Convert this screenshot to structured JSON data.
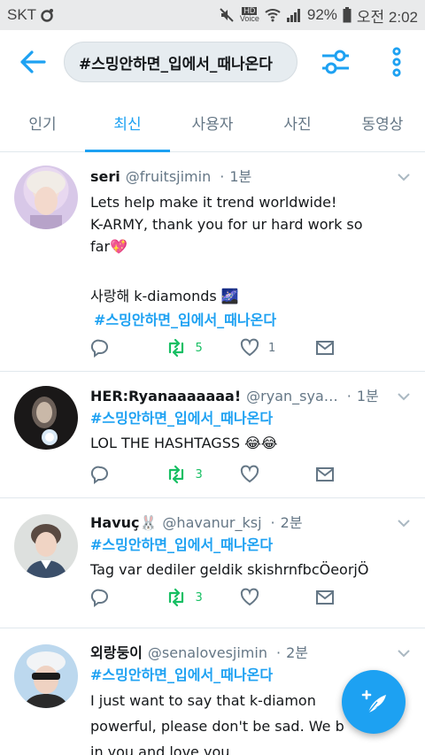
{
  "statusbar": {
    "carrier": "SKT",
    "hd_label": "HD",
    "voice_label": "Voice",
    "battery": "92%",
    "time": "오전 2:02"
  },
  "search": {
    "query": "#스밍안하면_입에서_때나온다"
  },
  "tabs": [
    {
      "label": "인기"
    },
    {
      "label": "최신",
      "active": true
    },
    {
      "label": "사용자"
    },
    {
      "label": "사진"
    },
    {
      "label": "동영상"
    }
  ],
  "tweets": [
    {
      "name": "seri",
      "handle": "@fruitsjimin",
      "time": "1분",
      "lines": [
        "Lets help make it trend worldwide!",
        "K-ARMY, thank you for ur hard work so",
        "far💖",
        "",
        "사랑해 k-diamonds 🌌"
      ],
      "hashtag": "#스밍안하면_입에서_때나온다",
      "retweets": "5",
      "likes": "1"
    },
    {
      "name": "HER:Ryanaaaaaaa!",
      "handle": "@ryan_sya…",
      "time": "1분",
      "hashtag": "#스밍안하면_입에서_때나온다",
      "lines": [
        "LOL THE HASHTAGSS 😂😂"
      ],
      "retweets": "3",
      "likes": ""
    },
    {
      "name": "Havuç🐰",
      "handle": "@havanur_ksj",
      "time": "2분",
      "hashtag": "#스밍안하면_입에서_때나온다",
      "lines": [
        "Tag var dediler geldik skishrnfbcÖeorjÖ"
      ],
      "retweets": "3",
      "likes": ""
    },
    {
      "name": "외랑둥이",
      "handle": "@senalovesjimin",
      "time": "2분",
      "hashtag": "#스밍안하면_입에서_때나온다",
      "lines": [
        "I just want to say that k-diamon",
        "powerful, please don't be sad. We b",
        "in you and love you."
      ],
      "retweets": "",
      "likes": ""
    }
  ],
  "colors": {
    "accent": "#1da1f2",
    "retweet": "#17bf63",
    "muted": "#657786"
  }
}
